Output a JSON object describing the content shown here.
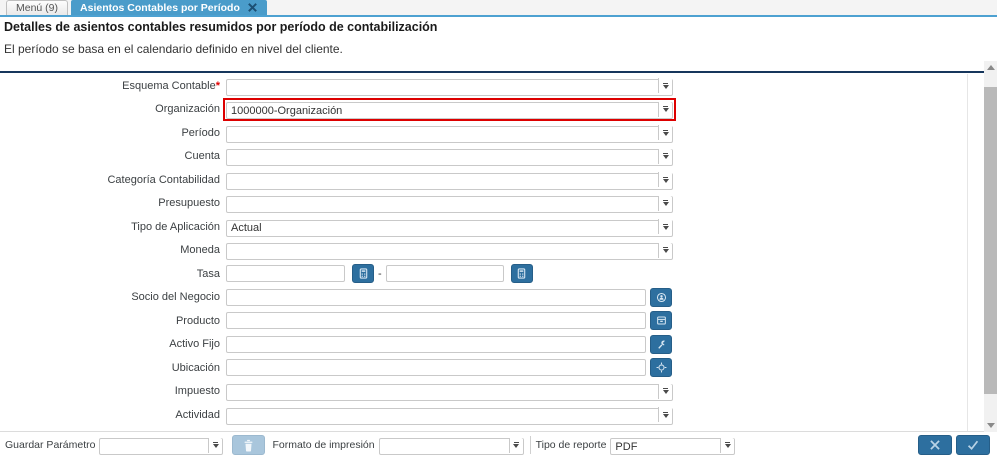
{
  "tabs": {
    "menu": {
      "label": "Menú (9)"
    },
    "active": {
      "label": "Asientos Contables por Período"
    }
  },
  "header": {
    "title": "Detalles de asientos contables resumidos por período de contabilización",
    "subtitle": "El período se basa en el calendario definido en nivel del cliente."
  },
  "form": {
    "fields": [
      {
        "label": "Esquema Contable",
        "required": "*",
        "value": ""
      },
      {
        "label": "Organización",
        "value": "1000000-Organización"
      },
      {
        "label": "Período",
        "value": ""
      },
      {
        "label": "Cuenta",
        "value": ""
      },
      {
        "label": "Categoría Contabilidad",
        "value": ""
      },
      {
        "label": "Presupuesto",
        "value": ""
      },
      {
        "label": "Tipo de Aplicación",
        "value": "Actual"
      },
      {
        "label": "Moneda",
        "value": ""
      },
      {
        "label": "Tasa",
        "value_from": "",
        "value_to": "",
        "separator": "-"
      },
      {
        "label": "Socio del Negocio",
        "value": ""
      },
      {
        "label": "Producto",
        "value": ""
      },
      {
        "label": "Activo Fijo",
        "value": ""
      },
      {
        "label": "Ubicación",
        "value": ""
      },
      {
        "label": "Impuesto",
        "value": ""
      },
      {
        "label": "Actividad",
        "value": ""
      }
    ]
  },
  "footer": {
    "save_param_label": "Guardar Parámetro",
    "save_param_value": "",
    "print_format_label": "Formato de impresión",
    "print_format_value": "",
    "report_type_label": "Tipo de reporte",
    "report_type_value": "PDF"
  },
  "icons": {
    "tab_close": "close-x",
    "dropdown": "chevron-down",
    "calculator": "calculator",
    "business_partner": "person-in-circle",
    "product": "product-box",
    "asset": "wrench",
    "location": "crosshair",
    "trash": "trash-can",
    "cancel": "x-mark",
    "confirm": "check-mark",
    "scroll_up": "triangle-up",
    "scroll_down": "triangle-down"
  },
  "colors": {
    "accent_tab_blue": "#4a9cca",
    "tabbar_underline": "#4da1d1",
    "navy_divider": "#16365c",
    "action_button_blue": "#2d6f9f",
    "disabled_trash_blue": "#a9c6dc",
    "highlight_red": "#dd0000",
    "field_border": "#c9c9c9"
  }
}
